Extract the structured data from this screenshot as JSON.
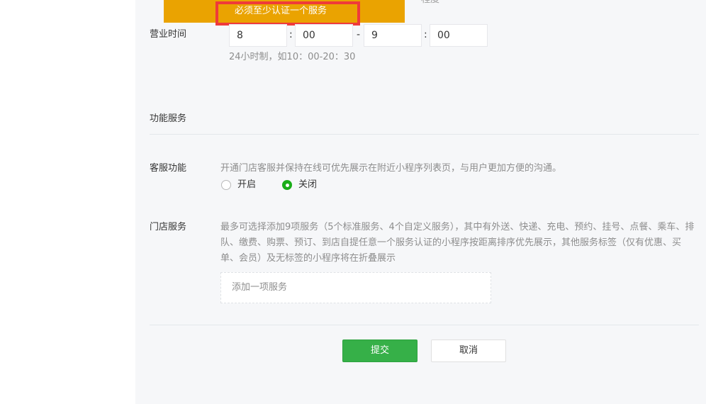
{
  "toast": {
    "message": "必须至少认证一个服务"
  },
  "top_cut_text": "程度",
  "business_hours": {
    "label": "营业时间",
    "start_hour": "8",
    "start_minute": "00",
    "end_hour": "9",
    "end_minute": "00",
    "colon": ":",
    "dash": "-",
    "hint": "24小时制，如10：00-20：30"
  },
  "function_services": {
    "title": "功能服务"
  },
  "customer_service": {
    "label": "客服功能",
    "description": "开通门店客服并保持在线可优先展示在附近小程序列表页，与用户更加方便的沟通。",
    "options": [
      {
        "label": "开启",
        "checked": false
      },
      {
        "label": "关闭",
        "checked": true
      }
    ]
  },
  "store_services": {
    "label": "门店服务",
    "description": "最多可选择添加9项服务（5个标准服务、4个自定义服务），其中有外送、快递、充电、预约、挂号、点餐、乘车、排队、缴费、购票、预订、到店自提任意一个服务认证的小程序按距离排序优先展示，其他服务标签（仅有优惠、买单、会员）及无标签的小程序将在折叠展示",
    "add_placeholder": "添加一项服务"
  },
  "actions": {
    "submit_label": "提交",
    "cancel_label": "取消"
  },
  "colors": {
    "toast_bg": "#eaa301",
    "highlight_border": "#ef3a3a",
    "primary_green": "#36b048",
    "radio_checked": "#1aad19",
    "panel_bg": "#f6f7f9"
  }
}
